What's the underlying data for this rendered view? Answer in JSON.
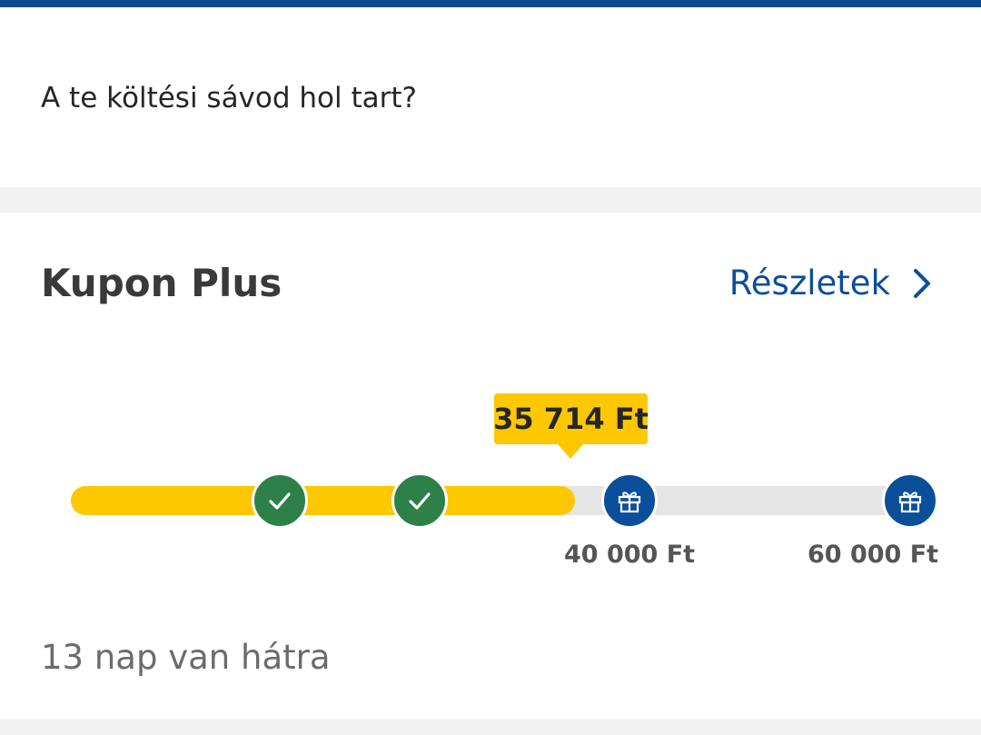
{
  "header": {
    "accent_color": "#0b4a8f"
  },
  "question": {
    "text": "A te költési sávod hol tart?"
  },
  "coupon": {
    "title": "Kupon Plus",
    "details_label": "Részletek",
    "current_amount": "35 714 Ft",
    "progress_fraction": 0.595,
    "colors": {
      "fill": "#fdc800",
      "track": "#e5e5e5",
      "completed": "#2e8049",
      "reward": "#0b4e9a",
      "link": "#0b4e9a"
    },
    "milestones": [
      {
        "state": "completed",
        "icon": "check-icon",
        "label": ""
      },
      {
        "state": "completed",
        "icon": "check-icon",
        "label": ""
      },
      {
        "state": "reward",
        "icon": "gift-icon",
        "label": "40 000 Ft"
      },
      {
        "state": "reward",
        "icon": "gift-icon",
        "label": "60 000 Ft"
      }
    ],
    "days_left": "13 nap van hátra"
  }
}
